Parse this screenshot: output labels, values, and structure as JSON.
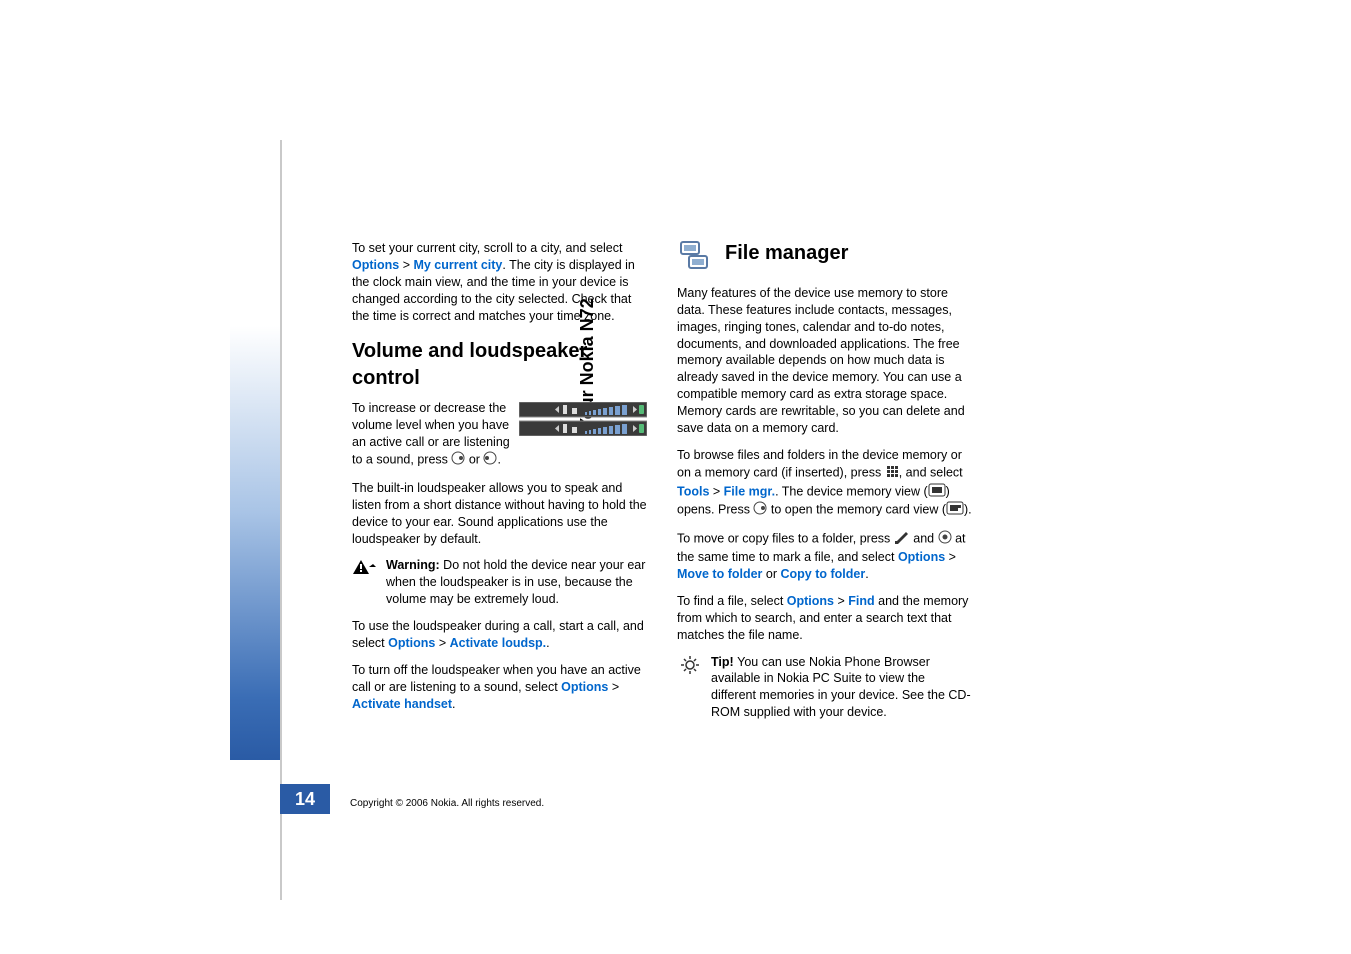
{
  "sidebar": {
    "vertical_title": "Your Nokia N72"
  },
  "left": {
    "p1_a": "To set your current city, scroll to a city, and select ",
    "p1_link1": "Options",
    "p1_gt": " > ",
    "p1_link2": "My current city",
    "p1_b": ". The city is displayed in the clock main view, and the time in your device is changed according to the city selected. Check that the time is correct and matches your time zone.",
    "h2_volume": "Volume and loudspeaker control",
    "p2_a": "To increase or decrease the volume level when you have an active call or are listening to a sound, press ",
    "p2_b": " or ",
    "p2_c": ".",
    "p3": "The built-in loudspeaker allows you to speak and listen from a short distance without having to hold the device to your ear. Sound applications use the loudspeaker by default.",
    "warn_label": "Warning: ",
    "warn_text": "Do not hold the device near your ear when the loudspeaker is in use, because the volume may be extremely loud.",
    "p4_a": "To use the loudspeaker during a call, start a call, and select ",
    "p4_link1": "Options",
    "p4_gt": " > ",
    "p4_link2": "Activate loudsp.",
    "p4_b": ".",
    "p5_a": "To turn off the loudspeaker when you have an active call or are listening to a sound, select ",
    "p5_link1": "Options",
    "p5_gt": " > ",
    "p5_link2": "Activate handset",
    "p5_b": "."
  },
  "right": {
    "h2_file": "File manager",
    "p1": "Many features of the device use memory to store data. These features include contacts, messages, images, ringing tones, calendar and to-do notes, documents, and downloaded applications. The free memory available depends on how much data is already saved in the device memory. You can use a compatible memory card as extra storage space. Memory cards are rewritable, so you can delete and save data on a memory card.",
    "p2_a": "To browse files and folders in the device memory or on a memory card (if inserted), press ",
    "p2_b": ", and select ",
    "p2_link1": "Tools",
    "p2_gt": " > ",
    "p2_link2": "File mgr.",
    "p2_c": ". The device memory view (",
    "p2_d": ") opens. Press ",
    "p2_e": " to open the memory card view (",
    "p2_f": ").",
    "p3_a": "To move or copy files to a folder, press ",
    "p3_b": " and ",
    "p3_c": " at the same time to mark a file, and select ",
    "p3_link1": "Options",
    "p3_gt": " > ",
    "p3_link2": "Move to folder",
    "p3_or": " or ",
    "p3_link3": "Copy to folder",
    "p3_d": ".",
    "p4_a": "To find a file, select ",
    "p4_link1": "Options",
    "p4_gt": " > ",
    "p4_link2": "Find",
    "p4_b": " and the memory from which to search, and enter a search text that matches the file name.",
    "tip_label": "Tip! ",
    "tip_text": "You can use Nokia Phone Browser available in Nokia PC Suite to view the different memories in your device. See the CD-ROM supplied with your device."
  },
  "footer": {
    "page_number": "14",
    "copyright": "Copyright © 2006 Nokia. All rights reserved."
  }
}
